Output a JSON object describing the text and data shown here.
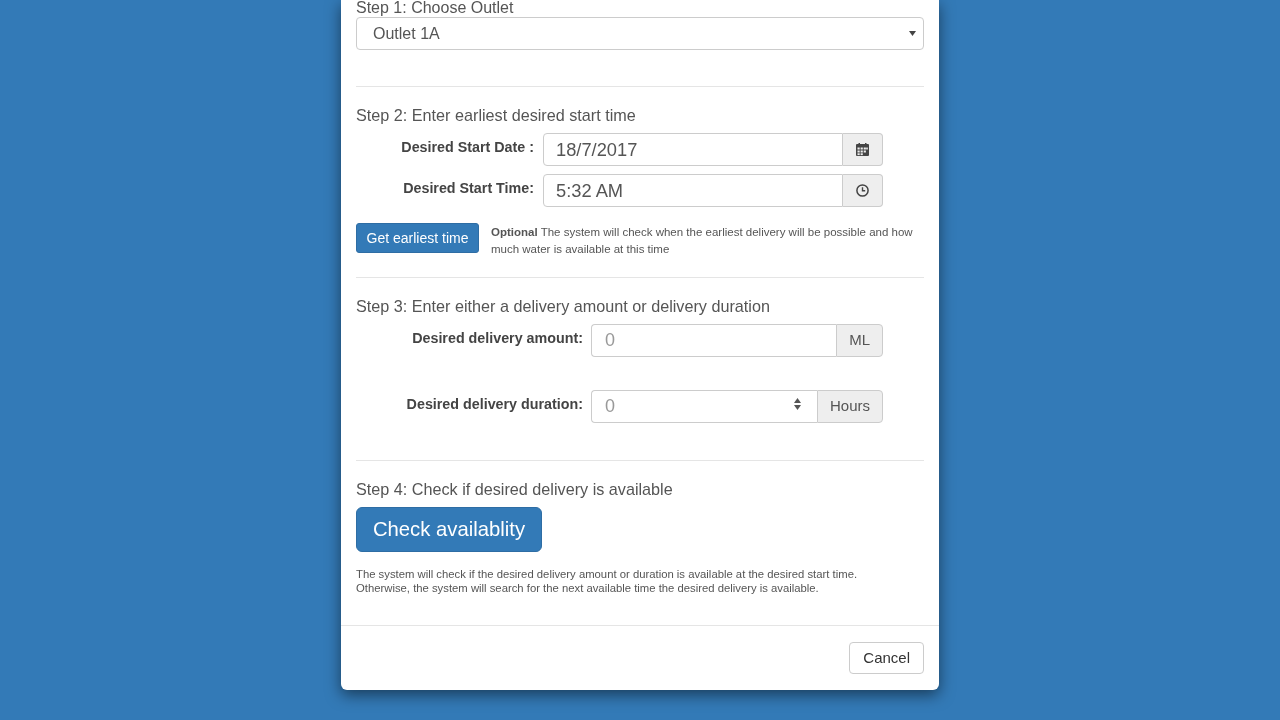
{
  "step1": {
    "label": "Step 1: Choose Outlet",
    "select": {
      "value": "Outlet 1A"
    }
  },
  "step2": {
    "label": "Step 2: Enter earliest desired start time",
    "fields": [
      {
        "kind": "date",
        "label": "Desired Start Date :",
        "value": "18/7/2017"
      },
      {
        "kind": "time",
        "label": "Desired Start Time:",
        "value": "5:32 AM"
      }
    ],
    "button": "Get earliest time",
    "help": "**Optional** The system will check when the earliest delivery will be possible and how much water is available at this time"
  },
  "step3": {
    "label": "Step 3: Enter either a delivery amount or delivery duration",
    "fields": [
      {
        "kind": "number",
        "label": "Desired delivery amount:",
        "placeholder": "0",
        "unit": "ML",
        "hovered": false
      },
      {
        "kind": "number",
        "label": "Desired delivery duration:",
        "placeholder": "0",
        "unit": "Hours",
        "hovered": true
      }
    ]
  },
  "step4": {
    "label": "Step 4: Check if desired delivery is available",
    "button": "Check availablity",
    "help": "The system will check if the desired delivery amount or duration is available at the desired start time. Otherwise, the system will search for the next available time the desired delivery is available."
  },
  "footer": {
    "buttons": [
      "Cancel"
    ]
  }
}
